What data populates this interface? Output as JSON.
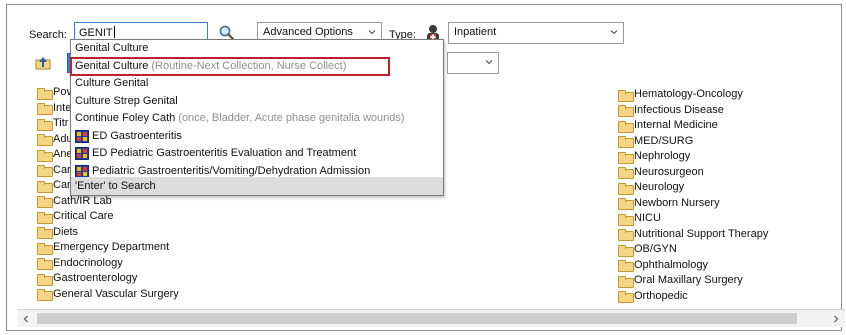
{
  "search": {
    "label": "Search:",
    "value": "GENIT"
  },
  "advanced_options": {
    "value": "Advanced Options"
  },
  "type": {
    "label": "Type:",
    "value": "Inpatient"
  },
  "suggestions": {
    "items": [
      {
        "text": "Genital Culture",
        "detail": ""
      },
      {
        "text": "Genital Culture",
        "detail": "(Routine-Next Collection, Nurse Collect)"
      },
      {
        "text": "Culture Genital",
        "detail": ""
      },
      {
        "text": "Culture Strep Genital",
        "detail": ""
      },
      {
        "text": "Continue Foley Cath",
        "detail": "(once, Bladder, Acute phase genitalia wounds)"
      },
      {
        "text": "ED Gastroenteritis",
        "detail": ""
      },
      {
        "text": "ED Pediatric Gastroenteritis Evaluation and Treatment",
        "detail": ""
      },
      {
        "text": "Pediatric Gastroenteritis/Vomiting/Dehydration Admission",
        "detail": ""
      }
    ],
    "footer": "'Enter' to Search"
  },
  "folders_left": [
    "Pov",
    "Inte",
    "Titr",
    "Adu",
    "Ane",
    "Car",
    "Car",
    "Cath/IR Lab",
    "Critical Care",
    "Diets",
    "Emergency Department",
    "Endocrinology",
    "Gastroenterology",
    "General Vascular Surgery"
  ],
  "folders_right": [
    "Hematology-Oncology",
    "Infectious Disease",
    "Internal Medicine",
    "MED/SURG",
    "Nephrology",
    "Neurosurgeon",
    "Neurology",
    "Newborn Nursery",
    "NICU",
    "Nutritional Support Therapy",
    "OB/GYN",
    "Ophthalmology",
    "Oral Maxillary Surgery",
    "Orthopedic"
  ],
  "colors": {
    "highlight_box": "#c0202a",
    "accent": "#3c7fd6",
    "folder": "#f5d585"
  },
  "icons": {
    "search": "magnifier-icon",
    "type": "inpatient-type-icon",
    "folder": "folder-icon",
    "powerplan": "powerplan-icon"
  }
}
